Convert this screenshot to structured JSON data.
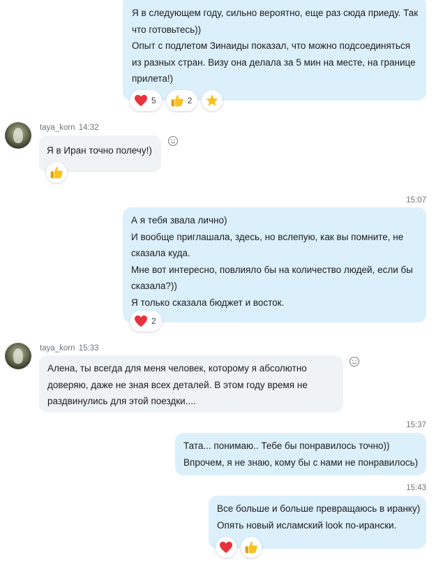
{
  "messages": [
    {
      "id": "m1",
      "lines": [
        "Я в следующем году, сильно вероятно, еще раз сюда приеду. Так",
        "что готовьтесь))",
        "Опыт с подлетом Зинаиды показал, что можно подсоединяться",
        "из разных стран. Визу она делала за 5 мин на месте, на границе",
        "прилета!)"
      ],
      "reactions": [
        {
          "emoji": "heart",
          "count": "5"
        },
        {
          "emoji": "thumbs-up",
          "count": "2"
        },
        {
          "emoji": "star",
          "count": ""
        }
      ]
    },
    {
      "id": "m2",
      "sender": "taya_korn",
      "time": "14:32",
      "lines": [
        "Я в Иран точно полечу!)"
      ],
      "reactions": [
        {
          "emoji": "thumbs-up",
          "count": ""
        }
      ]
    },
    {
      "id": "m3",
      "time": "15:07",
      "lines": [
        "А я тебя звала лично)",
        "И вообще приглашала, здесь, но вслепую, как вы помните, не",
        "сказала куда.",
        "Мне вот интересно, повлияло бы на количество людей, если бы",
        "сказала?))",
        "Я только сказала бюджет и восток."
      ],
      "reactions": [
        {
          "emoji": "heart",
          "count": "2"
        }
      ]
    },
    {
      "id": "m4",
      "sender": "taya_korn",
      "time": "15:33",
      "lines": [
        "Алена, ты всегда для меня человек, которому я абсолютно",
        "доверяю, даже не зная всех деталей. В этом году время не",
        "раздвинулись для этой поездки...."
      ]
    },
    {
      "id": "m5",
      "time": "15:37",
      "lines": [
        "Тата... понимаю.. Тебе бы понравилось точно))",
        "Впрочем, я не знаю, кому бы с нами не понравилось)"
      ]
    },
    {
      "id": "m6",
      "time": "15:43",
      "lines": [
        "Все больше и больше превращаюсь в иранку)",
        "Опять новый исламский look по-ирански."
      ],
      "reactions": [
        {
          "emoji": "heart",
          "count": ""
        },
        {
          "emoji": "thumbs-up",
          "count": ""
        }
      ]
    }
  ],
  "colors": {
    "outgoing_bubble": "#dbf0fb",
    "incoming_bubble": "#f0f3f6",
    "heart": "#e8323c",
    "thumb": "#f4b400",
    "star": "#f7c21c"
  },
  "icons": [
    "heart-icon",
    "thumbs-up-icon",
    "star-icon",
    "add-reaction-icon",
    "avatar"
  ]
}
